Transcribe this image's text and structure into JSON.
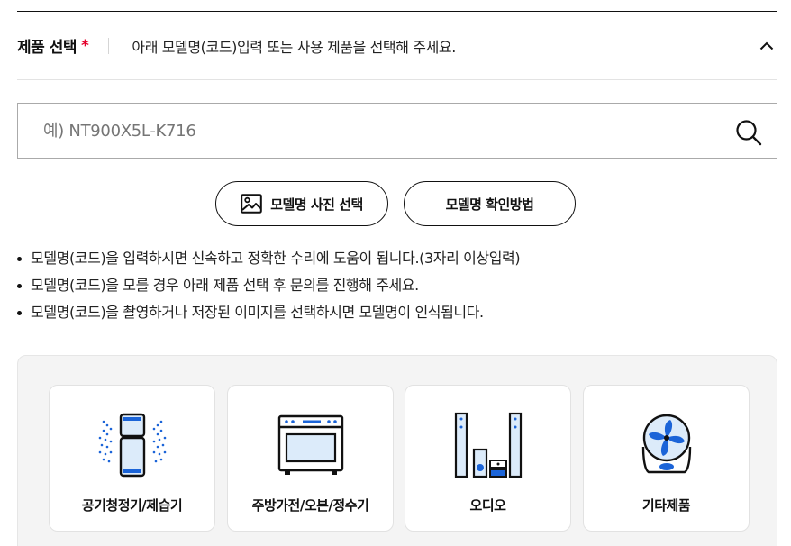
{
  "header": {
    "title": "제품 선택",
    "required_mark": "*",
    "description": "아래 모델명(코드)입력 또는 사용 제품을 선택해 주세요."
  },
  "search": {
    "placeholder": "예) NT900X5L-K716",
    "value": ""
  },
  "buttons": {
    "photo_label": "모델명 사진 선택",
    "guide_label": "모델명 확인방법"
  },
  "notes": [
    "모델명(코드)을 입력하시면 신속하고 정확한 수리에 도움이 됩니다.(3자리 이상입력)",
    "모델명(코드)을 모를 경우 아래 제품 선택 후 문의를 진행해 주세요.",
    "모델명(코드)을 촬영하거나 저장된 이미지를 선택하시면 모델명이 인식됩니다."
  ],
  "products": [
    {
      "label": "공기청정기/제습기",
      "icon": "air-purifier-icon"
    },
    {
      "label": "주방가전/오븐/정수기",
      "icon": "oven-icon"
    },
    {
      "label": "오디오",
      "icon": "audio-speaker-icon"
    },
    {
      "label": "기타제품",
      "icon": "fan-icon"
    }
  ],
  "colors": {
    "required": "#e4002b",
    "icon_accent": "#1b64d8",
    "icon_fill": "#dcebfa",
    "panel_bg": "#f4f4f4"
  }
}
